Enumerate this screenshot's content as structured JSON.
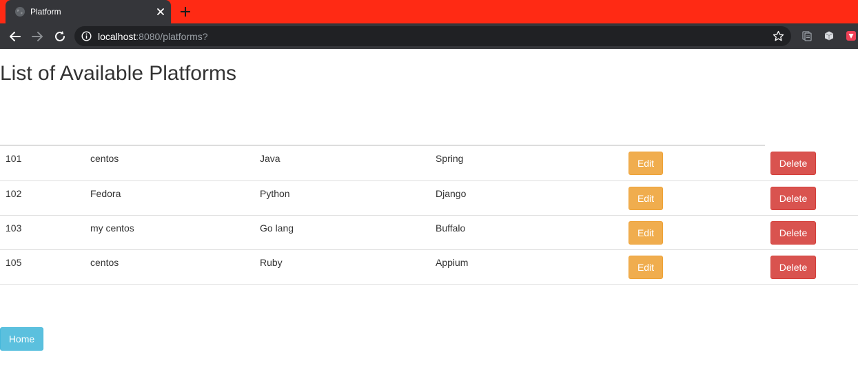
{
  "browser": {
    "tab_title": "Platform",
    "url_host": "localhost",
    "url_rest": ":8080/platforms?",
    "tabbar_color": "#ff2a14"
  },
  "page": {
    "title": "List of Available Platforms"
  },
  "table": {
    "rows": [
      {
        "id": "101",
        "name": "centos",
        "language": "Java",
        "framework": "Spring",
        "edit_label": "Edit",
        "delete_label": "Delete"
      },
      {
        "id": "102",
        "name": "Fedora",
        "language": "Python",
        "framework": "Django",
        "edit_label": "Edit",
        "delete_label": "Delete"
      },
      {
        "id": "103",
        "name": "my centos",
        "language": "Go lang",
        "framework": "Buffalo",
        "edit_label": "Edit",
        "delete_label": "Delete"
      },
      {
        "id": "105",
        "name": "centos",
        "language": "Ruby",
        "framework": "Appium",
        "edit_label": "Edit",
        "delete_label": "Delete"
      }
    ]
  },
  "home_button": {
    "label": "Home"
  },
  "icons": {
    "tab_favicon": "globe-icon",
    "tab_close": "close-icon",
    "new_tab": "plus-icon",
    "back": "back-arrow-icon",
    "forward": "forward-arrow-icon",
    "reload": "reload-icon",
    "site_info": "info-icon",
    "bookmark": "star-icon",
    "extensions": [
      "document-extension-icon",
      "cube-extension-icon",
      "shield-extension-icon"
    ]
  }
}
